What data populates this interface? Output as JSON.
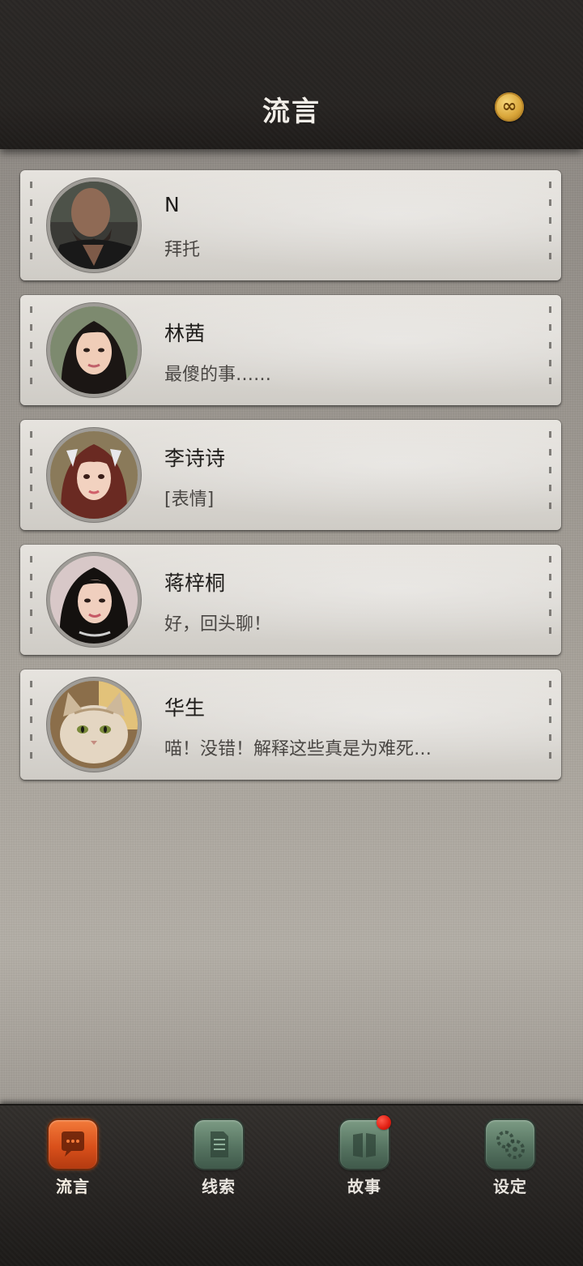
{
  "header": {
    "title": "流言",
    "coin_icon": "infinity-coin-icon"
  },
  "messages": [
    {
      "name": "N",
      "preview": "拜托",
      "avatar": "man-portrait-avatar"
    },
    {
      "name": "林茜",
      "preview": "最傻的事……",
      "avatar": "woman-portrait-avatar"
    },
    {
      "name": "李诗诗",
      "preview": "[表情]",
      "avatar": "woman-portrait-avatar"
    },
    {
      "name": "蒋梓桐",
      "preview": "好，回头聊！",
      "avatar": "woman-portrait-avatar"
    },
    {
      "name": "华生",
      "preview": "喵！没错！解释这些真是为难死…",
      "avatar": "cat-portrait-avatar"
    }
  ],
  "nav": {
    "items": [
      {
        "label": "流言",
        "icon": "chat-bubble-icon",
        "active": true
      },
      {
        "label": "线索",
        "icon": "document-icon",
        "active": false
      },
      {
        "label": "故事",
        "icon": "book-icon",
        "active": false,
        "notification": true
      },
      {
        "label": "设定",
        "icon": "gear-icon",
        "active": false
      }
    ]
  },
  "colors": {
    "accent_active": "#d9501b",
    "nav_inactive": "#567461",
    "notification": "#e01e12",
    "coin": "#d9a63a"
  }
}
